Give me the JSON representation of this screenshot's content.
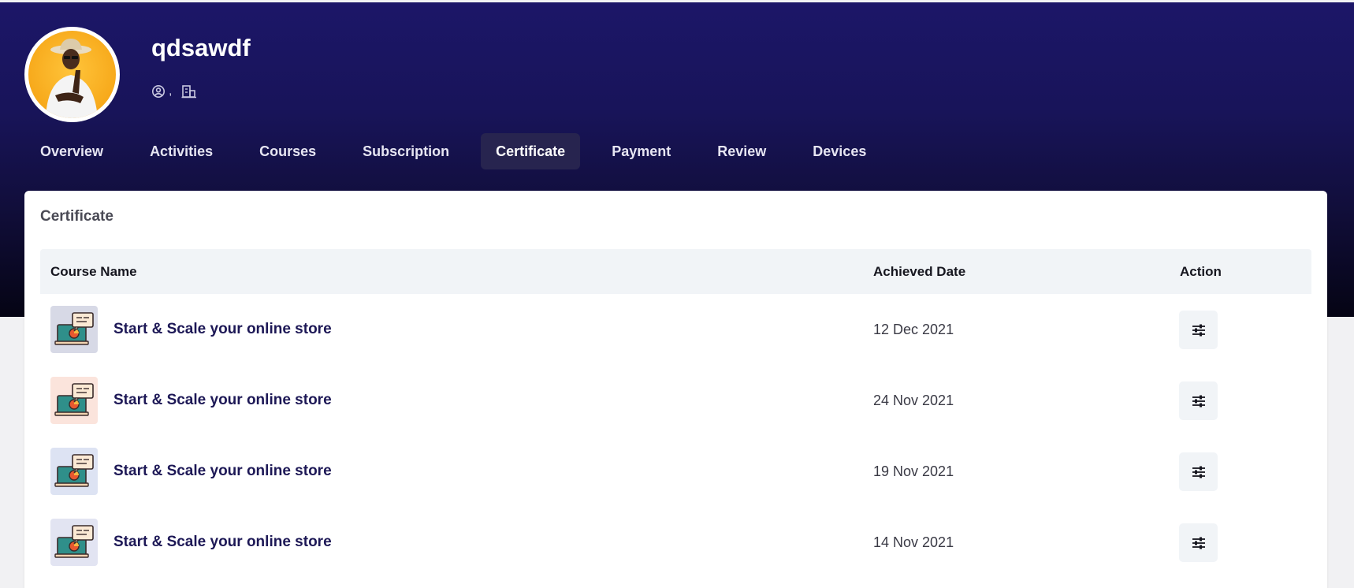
{
  "profile": {
    "username": "qdsawdf",
    "location_text": ",",
    "icons": {
      "location": "location-pin-icon",
      "organization": "building-icon"
    }
  },
  "tabs": [
    {
      "label": "Overview",
      "active": false
    },
    {
      "label": "Activities",
      "active": false
    },
    {
      "label": "Courses",
      "active": false
    },
    {
      "label": "Subscription",
      "active": false
    },
    {
      "label": "Certificate",
      "active": true
    },
    {
      "label": "Payment",
      "active": false
    },
    {
      "label": "Review",
      "active": false
    },
    {
      "label": "Devices",
      "active": false
    }
  ],
  "certificate": {
    "title": "Certificate",
    "columns": {
      "course": "Course Name",
      "date": "Achieved Date",
      "action": "Action"
    },
    "rows": [
      {
        "course": "Start & Scale your online store",
        "date": "12 Dec 2021",
        "thumb_bg": "#d7d9e6"
      },
      {
        "course": "Start & Scale your online store",
        "date": "24 Nov 2021",
        "thumb_bg": "#fbe4dc"
      },
      {
        "course": "Start & Scale your online store",
        "date": "19 Nov 2021",
        "thumb_bg": "#dde3f3"
      },
      {
        "course": "Start & Scale your online store",
        "date": "14 Nov 2021",
        "thumb_bg": "#e2e4f2"
      }
    ],
    "action_icon": "sliders-icon"
  },
  "colors": {
    "hero_top": "#1c1668",
    "hero_bottom": "#050414",
    "accent_text": "#1d1856",
    "active_tab_bg": "#27244f"
  }
}
